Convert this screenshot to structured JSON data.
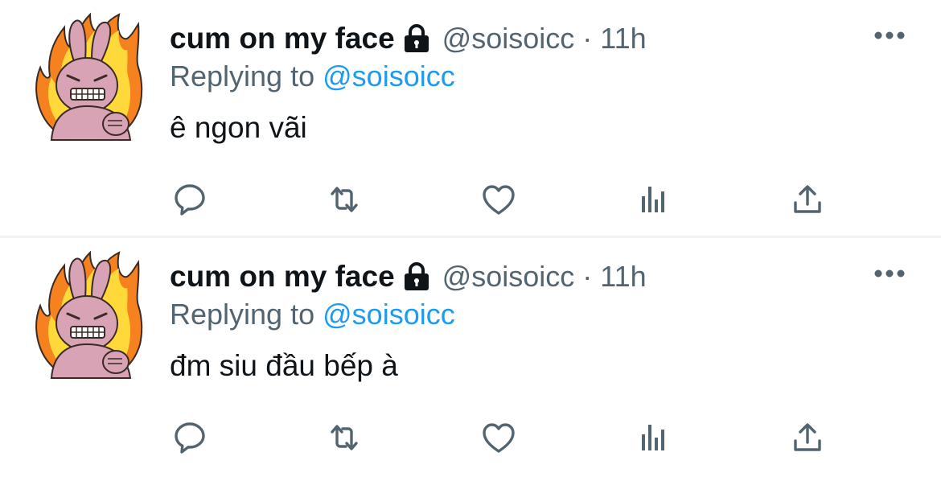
{
  "tweets": [
    {
      "author": {
        "display_name": "cum on my face",
        "handle": "@soisoicc",
        "protected_icon": "lock-icon"
      },
      "time": "11h",
      "separator": "·",
      "replying_to": {
        "prefix": "Replying to",
        "mention": "@soisoicc"
      },
      "text": "ê ngon vãi",
      "actions": [
        "reply-icon",
        "retweet-icon",
        "like-icon",
        "views-icon",
        "share-icon"
      ]
    },
    {
      "author": {
        "display_name": "cum on my face",
        "handle": "@soisoicc",
        "protected_icon": "lock-icon"
      },
      "time": "11h",
      "separator": "·",
      "replying_to": {
        "prefix": "Replying to",
        "mention": "@soisoicc"
      },
      "text": "đm siu đầu bếp à",
      "actions": [
        "reply-icon",
        "retweet-icon",
        "like-icon",
        "views-icon",
        "share-icon"
      ]
    }
  ],
  "colors": {
    "text_primary": "#0f1419",
    "text_secondary": "#536471",
    "mention": "#1d9bf0",
    "divider": "#eff3f4"
  }
}
